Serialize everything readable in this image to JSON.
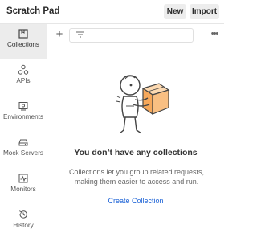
{
  "header": {
    "title": "Scratch Pad",
    "new_label": "New",
    "import_label": "Import"
  },
  "sidebar": {
    "items": [
      {
        "label": "Collections",
        "icon": "collections-icon",
        "active": true
      },
      {
        "label": "APIs",
        "icon": "apis-icon",
        "active": false
      },
      {
        "label": "Environments",
        "icon": "environments-icon",
        "active": false
      },
      {
        "label": "Mock Servers",
        "icon": "mock-servers-icon",
        "active": false
      },
      {
        "label": "Monitors",
        "icon": "monitors-icon",
        "active": false
      },
      {
        "label": "History",
        "icon": "history-icon",
        "active": false
      }
    ]
  },
  "toolbar": {
    "add_icon": "plus-icon",
    "filter_icon": "filter-icon",
    "more_icon": "more-options-icon"
  },
  "empty_state": {
    "illustration": "astronaut-carrying-box",
    "title": "You don’t have any collections",
    "description_line1": "Collections let you group related requests,",
    "description_line2": "making them easier to access and run.",
    "cta_label": "Create Collection"
  },
  "colors": {
    "accent": "#1d63d6",
    "illustration_orange": "#f6a85b"
  }
}
